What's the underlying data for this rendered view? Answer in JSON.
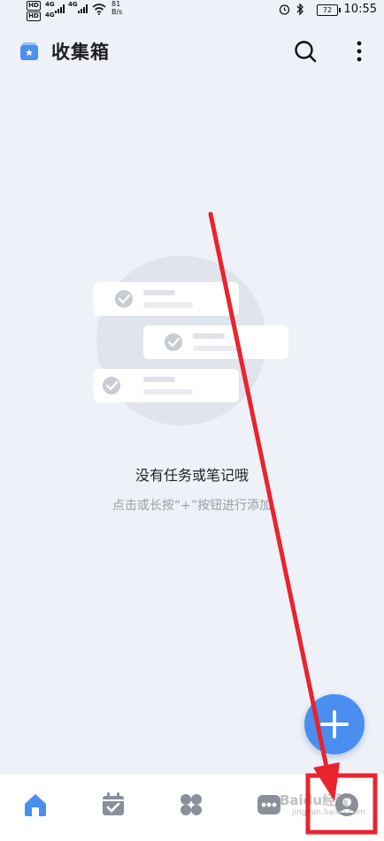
{
  "status_bar": {
    "hd_label": "HD",
    "network_label": "4G",
    "speed_value": "81",
    "speed_unit": "B/s",
    "battery": "72",
    "time": "10:55"
  },
  "header": {
    "title": "收集箱",
    "inbox_icon": "inbox-star-icon",
    "search_icon": "search-icon",
    "more_icon": "more-vertical-icon"
  },
  "empty_state": {
    "title": "没有任务或笔记哦",
    "hint": "点击或长按“+”按钮进行添加"
  },
  "fab": {
    "icon": "plus-icon"
  },
  "bottom_nav": {
    "items": [
      {
        "icon": "home-icon",
        "active": true
      },
      {
        "icon": "calendar-check-icon",
        "active": false
      },
      {
        "icon": "grid-icon",
        "active": false
      },
      {
        "icon": "more-horizontal-icon",
        "active": false
      },
      {
        "icon": "profile-icon",
        "active": false
      }
    ]
  },
  "watermark": {
    "brand": "Baidu经验",
    "sub": "jingyan.baidu.com"
  },
  "colors": {
    "background": "#eef1f8",
    "accent": "#4a8ef0",
    "annotation": "#e8242e",
    "icon_gray": "#8a8f99"
  }
}
